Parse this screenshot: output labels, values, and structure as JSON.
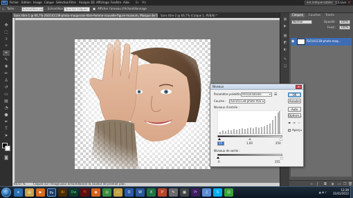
{
  "app": {
    "logo": "Ps",
    "menu": [
      "Fichier",
      "Edition",
      "Image",
      "Calque",
      "Sélection",
      "Filtre",
      "Analyse",
      "3D",
      "Affichage",
      "Fenêtre",
      "Aide"
    ],
    "workspace": "ess.indispensables",
    "cs_live": "CS Live"
  },
  "options": {
    "size_label": "Taille :",
    "sample_label": "Echantillon ponctuel",
    "sample_label_2": "Echantillon :",
    "sample_value": "Tous les calques",
    "show_ring_label": "Afficher l'anneau d'échantillonnage"
  },
  "tabs": [
    {
      "label": "Sans titre-1 @ 66,7% (ISO141138-photo-maquerain-libre-femme-nouvelle-figure-museum, Masque de fusion/8) *",
      "active": true
    },
    {
      "label": "Sans titre-2 @ 66,7% (Calque 1, RVB/8) *",
      "active": false
    }
  ],
  "status": {
    "zoom": "66,67 %",
    "info": "Cliquez sur l'image pour échantillonner la couleur de premier plan."
  },
  "panels": {
    "tabs": [
      "Calques",
      "Couches",
      "Tracés"
    ],
    "blend_mode": "Normal",
    "opacity_label": "Opacité :",
    "opacity_value": "100%",
    "fill_label": "Fond :",
    "fill_value": "100%",
    "layer_name": "ISO141138-photo-maq..."
  },
  "dialog": {
    "title": "Niveaux",
    "preset_label": "Paramètre prédéfini :",
    "preset_value": "Personnalisée",
    "channel_label": "Couche :",
    "channel_value": "ISO141138-photo-mar...",
    "input_label": "Niveaux d'entrée :",
    "input_values": [
      "15",
      "1,00",
      "250"
    ],
    "output_label": "Niveaux de sortie :",
    "output_values": [
      "0",
      "255"
    ],
    "buttons": {
      "ok": "OK",
      "cancel": "Annuler",
      "auto": "Auto",
      "options": "Options..."
    },
    "preview_label": "Aperçu",
    "preview_checked": true,
    "preset_menu_icon": "menu-list-icon"
  },
  "taskbar": {
    "apps": [
      "ie",
      "explorer",
      "media",
      "photoshop",
      "illustrator",
      "dreamweaver",
      "flash",
      "firefox",
      "chrome",
      "folder",
      "outlook",
      "word",
      "excel",
      "powerpoint",
      "paint",
      "calculator",
      "premiere",
      "itunes",
      "skype",
      "messenger"
    ],
    "time": "13:39",
    "date": "31/01/2012"
  },
  "colors": {
    "accent": "#3f6db5",
    "default_button": "#3c7fb1"
  }
}
